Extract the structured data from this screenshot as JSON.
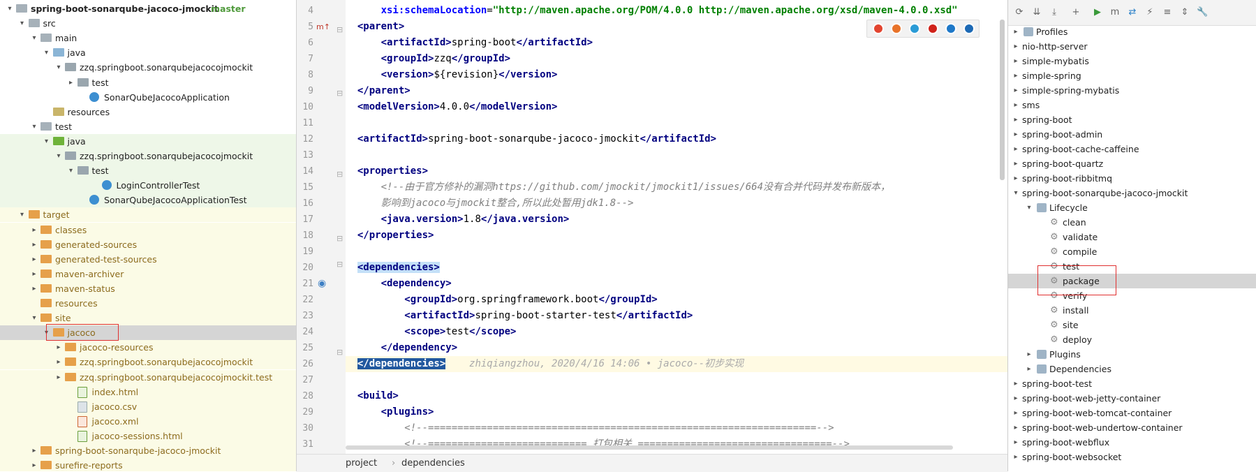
{
  "project_tree": [
    {
      "label": "spring-boot-sonarqube-jacoco-jmockit",
      "branch": "master",
      "depth": 0,
      "arrow": "▾",
      "icon": "folder"
    },
    {
      "label": "src",
      "depth": 1,
      "arrow": "▾",
      "icon": "folder"
    },
    {
      "label": "main",
      "depth": 2,
      "arrow": "▾",
      "icon": "folder"
    },
    {
      "label": "java",
      "depth": 3,
      "arrow": "▾",
      "icon": "src"
    },
    {
      "label": "zzq.springboot.sonarqubejacocojmockit",
      "depth": 4,
      "arrow": "▾",
      "icon": "pkg"
    },
    {
      "label": "test",
      "depth": 5,
      "arrow": "▸",
      "icon": "pkg"
    },
    {
      "label": "SonarQubeJacocoApplication",
      "depth": 6,
      "arrow": "",
      "icon": "class"
    },
    {
      "label": "resources",
      "depth": 3,
      "arrow": "",
      "icon": "res"
    },
    {
      "label": "test",
      "depth": 2,
      "arrow": "▾",
      "icon": "folder"
    },
    {
      "label": "java",
      "depth": 3,
      "arrow": "▾",
      "icon": "green",
      "band": "green"
    },
    {
      "label": "zzq.springboot.sonarqubejacocojmockit",
      "depth": 4,
      "arrow": "▾",
      "icon": "pkg",
      "band": "green"
    },
    {
      "label": "test",
      "depth": 5,
      "arrow": "▾",
      "icon": "pkg",
      "band": "green"
    },
    {
      "label": "LoginControllerTest",
      "depth": 7,
      "arrow": "",
      "icon": "class",
      "band": "green"
    },
    {
      "label": "SonarQubeJacocoApplicationTest",
      "depth": 6,
      "arrow": "",
      "icon": "class",
      "band": "green"
    },
    {
      "label": "target",
      "depth": 1,
      "arrow": "▾",
      "icon": "orange",
      "band": "yellow"
    },
    {
      "label": "classes",
      "depth": 2,
      "arrow": "▸",
      "icon": "orange",
      "band": "yellow"
    },
    {
      "label": "generated-sources",
      "depth": 2,
      "arrow": "▸",
      "icon": "orange",
      "band": "yellow"
    },
    {
      "label": "generated-test-sources",
      "depth": 2,
      "arrow": "▸",
      "icon": "orange",
      "band": "yellow"
    },
    {
      "label": "maven-archiver",
      "depth": 2,
      "arrow": "▸",
      "icon": "orange",
      "band": "yellow"
    },
    {
      "label": "maven-status",
      "depth": 2,
      "arrow": "▸",
      "icon": "orange",
      "band": "yellow"
    },
    {
      "label": "resources",
      "depth": 2,
      "arrow": "",
      "icon": "orange",
      "band": "yellow"
    },
    {
      "label": "site",
      "depth": 2,
      "arrow": "▾",
      "icon": "orange",
      "band": "yellow"
    },
    {
      "label": "jacoco",
      "depth": 3,
      "arrow": "▾",
      "icon": "orange",
      "band": "selected"
    },
    {
      "label": "jacoco-resources",
      "depth": 4,
      "arrow": "▸",
      "icon": "orange",
      "band": "yellow"
    },
    {
      "label": "zzq.springboot.sonarqubejacocojmockit",
      "depth": 4,
      "arrow": "▸",
      "icon": "orange",
      "band": "yellow"
    },
    {
      "label": "zzq.springboot.sonarqubejacocojmockit.test",
      "depth": 4,
      "arrow": "▸",
      "icon": "orange",
      "band": "yellow"
    },
    {
      "label": "index.html",
      "depth": 5,
      "arrow": "",
      "icon": "html",
      "band": "yellow"
    },
    {
      "label": "jacoco.csv",
      "depth": 5,
      "arrow": "",
      "icon": "file",
      "band": "yellow"
    },
    {
      "label": "jacoco.xml",
      "depth": 5,
      "arrow": "",
      "icon": "xml",
      "band": "yellow"
    },
    {
      "label": "jacoco-sessions.html",
      "depth": 5,
      "arrow": "",
      "icon": "html",
      "band": "yellow"
    },
    {
      "label": "spring-boot-sonarqube-jacoco-jmockit",
      "depth": 2,
      "arrow": "▸",
      "icon": "orange",
      "band": "yellow"
    },
    {
      "label": "surefire-reports",
      "depth": 2,
      "arrow": "▸",
      "icon": "orange",
      "band": "yellow"
    }
  ],
  "editor": {
    "lines": [
      {
        "n": "4",
        "segs": [
          [
            "    ",
            ""
          ],
          [
            "xsi:schemaLocation",
            "attr"
          ],
          [
            "=",
            ""
          ],
          [
            "\"http://maven.apache.org/POM/4.0.0 http://maven.apache.org/xsd/maven-4.0.0.xsd\"",
            "str"
          ]
        ]
      },
      {
        "n": "5",
        "segs": [
          [
            "<parent>",
            "tagb"
          ]
        ]
      },
      {
        "n": "6",
        "segs": [
          [
            "    ",
            ""
          ],
          [
            "<artifactId>",
            "tagb"
          ],
          [
            "spring-boot",
            ""
          ],
          [
            "</artifactId>",
            "tagb"
          ]
        ]
      },
      {
        "n": "7",
        "segs": [
          [
            "    ",
            ""
          ],
          [
            "<groupId>",
            "tagb"
          ],
          [
            "zzq",
            ""
          ],
          [
            "</groupId>",
            "tagb"
          ]
        ]
      },
      {
        "n": "8",
        "segs": [
          [
            "    ",
            ""
          ],
          [
            "<version>",
            "tagb"
          ],
          [
            "${revision}",
            ""
          ],
          [
            "</version>",
            "tagb"
          ]
        ]
      },
      {
        "n": "9",
        "segs": [
          [
            "</parent>",
            "tagb"
          ]
        ]
      },
      {
        "n": "10",
        "segs": [
          [
            "<modelVersion>",
            "tagb"
          ],
          [
            "4.0.0",
            ""
          ],
          [
            "</modelVersion>",
            "tagb"
          ]
        ]
      },
      {
        "n": "11",
        "segs": []
      },
      {
        "n": "12",
        "segs": [
          [
            "<artifactId>",
            "tagb"
          ],
          [
            "spring-boot-sonarqube-jacoco-jmockit",
            ""
          ],
          [
            "</artifactId>",
            "tagb"
          ]
        ]
      },
      {
        "n": "13",
        "segs": []
      },
      {
        "n": "14",
        "segs": [
          [
            "<properties>",
            "tagb"
          ]
        ]
      },
      {
        "n": "15",
        "segs": [
          [
            "    ",
            ""
          ],
          [
            "<!--由于官方修补的漏洞https://github.com/jmockit/jmockit1/issues/664没有合并代码并发布新版本，",
            "cmt"
          ]
        ]
      },
      {
        "n": "16",
        "segs": [
          [
            "    ",
            ""
          ],
          [
            "影响到jacoco与jmockit整合,所以此处暂用jdk1.8-->",
            "cmt"
          ]
        ]
      },
      {
        "n": "17",
        "segs": [
          [
            "    ",
            ""
          ],
          [
            "<java.version>",
            "tagb"
          ],
          [
            "1.8",
            ""
          ],
          [
            "</java.version>",
            "tagb"
          ]
        ]
      },
      {
        "n": "18",
        "segs": [
          [
            "</properties>",
            "tagb"
          ]
        ]
      },
      {
        "n": "19",
        "segs": []
      },
      {
        "n": "20",
        "segs": [
          [
            "<dependencies>",
            "tagb hl"
          ]
        ]
      },
      {
        "n": "21",
        "segs": [
          [
            "    ",
            ""
          ],
          [
            "<dependency>",
            "tagb"
          ]
        ]
      },
      {
        "n": "22",
        "segs": [
          [
            "        ",
            ""
          ],
          [
            "<groupId>",
            "tagb"
          ],
          [
            "org.springframework.boot",
            ""
          ],
          [
            "</groupId>",
            "tagb"
          ]
        ]
      },
      {
        "n": "23",
        "segs": [
          [
            "        ",
            ""
          ],
          [
            "<artifactId>",
            "tagb"
          ],
          [
            "spring-boot-starter-test",
            ""
          ],
          [
            "</artifactId>",
            "tagb"
          ]
        ]
      },
      {
        "n": "24",
        "segs": [
          [
            "        ",
            ""
          ],
          [
            "<scope>",
            "tagb"
          ],
          [
            "test",
            ""
          ],
          [
            "</scope>",
            "tagb"
          ]
        ]
      },
      {
        "n": "25",
        "segs": [
          [
            "    ",
            ""
          ],
          [
            "</dependency>",
            "tagb"
          ]
        ]
      },
      {
        "n": "26",
        "segs": [
          [
            "</dependencies>",
            "tagb sel"
          ],
          [
            "    zhiqiangzhou, 2020/4/16 14:06 • jacoco--初步实现",
            "blame"
          ]
        ],
        "current": true
      },
      {
        "n": "27",
        "segs": []
      },
      {
        "n": "28",
        "segs": [
          [
            "<build>",
            "tagb"
          ]
        ]
      },
      {
        "n": "29",
        "segs": [
          [
            "    ",
            ""
          ],
          [
            "<plugins>",
            "tagb"
          ]
        ]
      },
      {
        "n": "30",
        "segs": [
          [
            "        ",
            ""
          ],
          [
            "<!--==================================================================-->",
            "cmt"
          ]
        ]
      },
      {
        "n": "31",
        "segs": [
          [
            "        ",
            ""
          ],
          [
            "<!--=========================== 打包相关 =================================-->",
            "cmt"
          ]
        ]
      }
    ]
  },
  "browser_icons": [
    "chrome-icon",
    "firefox-icon",
    "safari-icon",
    "opera-icon",
    "ie-icon",
    "edge-icon"
  ],
  "breadcrumb": {
    "items": [
      "project",
      "dependencies"
    ],
    "separator": "›"
  },
  "maven": {
    "toolbar": [
      "reload-icon",
      "generate-sources-icon",
      "download-icon",
      "add-icon",
      "run-icon",
      "execute-goal-icon",
      "toggle-offline-icon",
      "skip-tests-icon",
      "show-dependencies-icon",
      "collapse-all-icon",
      "settings-icon"
    ],
    "items": [
      {
        "label": "Profiles",
        "depth": 0,
        "arrow": "▸",
        "icon": "folder"
      },
      {
        "label": "nio-http-server",
        "depth": 0,
        "arrow": "▸",
        "icon": "module"
      },
      {
        "label": "simple-mybatis",
        "depth": 0,
        "arrow": "▸",
        "icon": "module"
      },
      {
        "label": "simple-spring",
        "depth": 0,
        "arrow": "▸",
        "icon": "module"
      },
      {
        "label": "simple-spring-mybatis",
        "depth": 0,
        "arrow": "▸",
        "icon": "module"
      },
      {
        "label": "sms",
        "depth": 0,
        "arrow": "▸",
        "icon": "module"
      },
      {
        "label": "spring-boot",
        "depth": 0,
        "arrow": "▸",
        "icon": "module"
      },
      {
        "label": "spring-boot-admin",
        "depth": 0,
        "arrow": "▸",
        "icon": "module"
      },
      {
        "label": "spring-boot-cache-caffeine",
        "depth": 0,
        "arrow": "▸",
        "icon": "module"
      },
      {
        "label": "spring-boot-quartz",
        "depth": 0,
        "arrow": "▸",
        "icon": "module"
      },
      {
        "label": "spring-boot-ribbitmq",
        "depth": 0,
        "arrow": "▸",
        "icon": "module"
      },
      {
        "label": "spring-boot-sonarqube-jacoco-jmockit",
        "depth": 0,
        "arrow": "▾",
        "icon": "module"
      },
      {
        "label": "Lifecycle",
        "depth": 1,
        "arrow": "▾",
        "icon": "folder"
      },
      {
        "label": "clean",
        "depth": 2,
        "arrow": "",
        "icon": "gear"
      },
      {
        "label": "validate",
        "depth": 2,
        "arrow": "",
        "icon": "gear"
      },
      {
        "label": "compile",
        "depth": 2,
        "arrow": "",
        "icon": "gear"
      },
      {
        "label": "test",
        "depth": 2,
        "arrow": "",
        "icon": "gear"
      },
      {
        "label": "package",
        "depth": 2,
        "arrow": "",
        "icon": "gear",
        "selected": true
      },
      {
        "label": "verify",
        "depth": 2,
        "arrow": "",
        "icon": "gear"
      },
      {
        "label": "install",
        "depth": 2,
        "arrow": "",
        "icon": "gear"
      },
      {
        "label": "site",
        "depth": 2,
        "arrow": "",
        "icon": "gear"
      },
      {
        "label": "deploy",
        "depth": 2,
        "arrow": "",
        "icon": "gear"
      },
      {
        "label": "Plugins",
        "depth": 1,
        "arrow": "▸",
        "icon": "folder"
      },
      {
        "label": "Dependencies",
        "depth": 1,
        "arrow": "▸",
        "icon": "folder"
      },
      {
        "label": "spring-boot-test",
        "depth": 0,
        "arrow": "▸",
        "icon": "module"
      },
      {
        "label": "spring-boot-web-jetty-container",
        "depth": 0,
        "arrow": "▸",
        "icon": "module"
      },
      {
        "label": "spring-boot-web-tomcat-container",
        "depth": 0,
        "arrow": "▸",
        "icon": "module"
      },
      {
        "label": "spring-boot-web-undertow-container",
        "depth": 0,
        "arrow": "▸",
        "icon": "module"
      },
      {
        "label": "spring-boot-webflux",
        "depth": 0,
        "arrow": "▸",
        "icon": "module"
      },
      {
        "label": "spring-boot-websocket",
        "depth": 0,
        "arrow": "▸",
        "icon": "module"
      }
    ]
  },
  "colors": {
    "selection": "#d5d5d5",
    "highlight_box": "#e03030",
    "tag": "#000080",
    "attr": "#0000ff",
    "string": "#008000",
    "comment": "#808080"
  }
}
